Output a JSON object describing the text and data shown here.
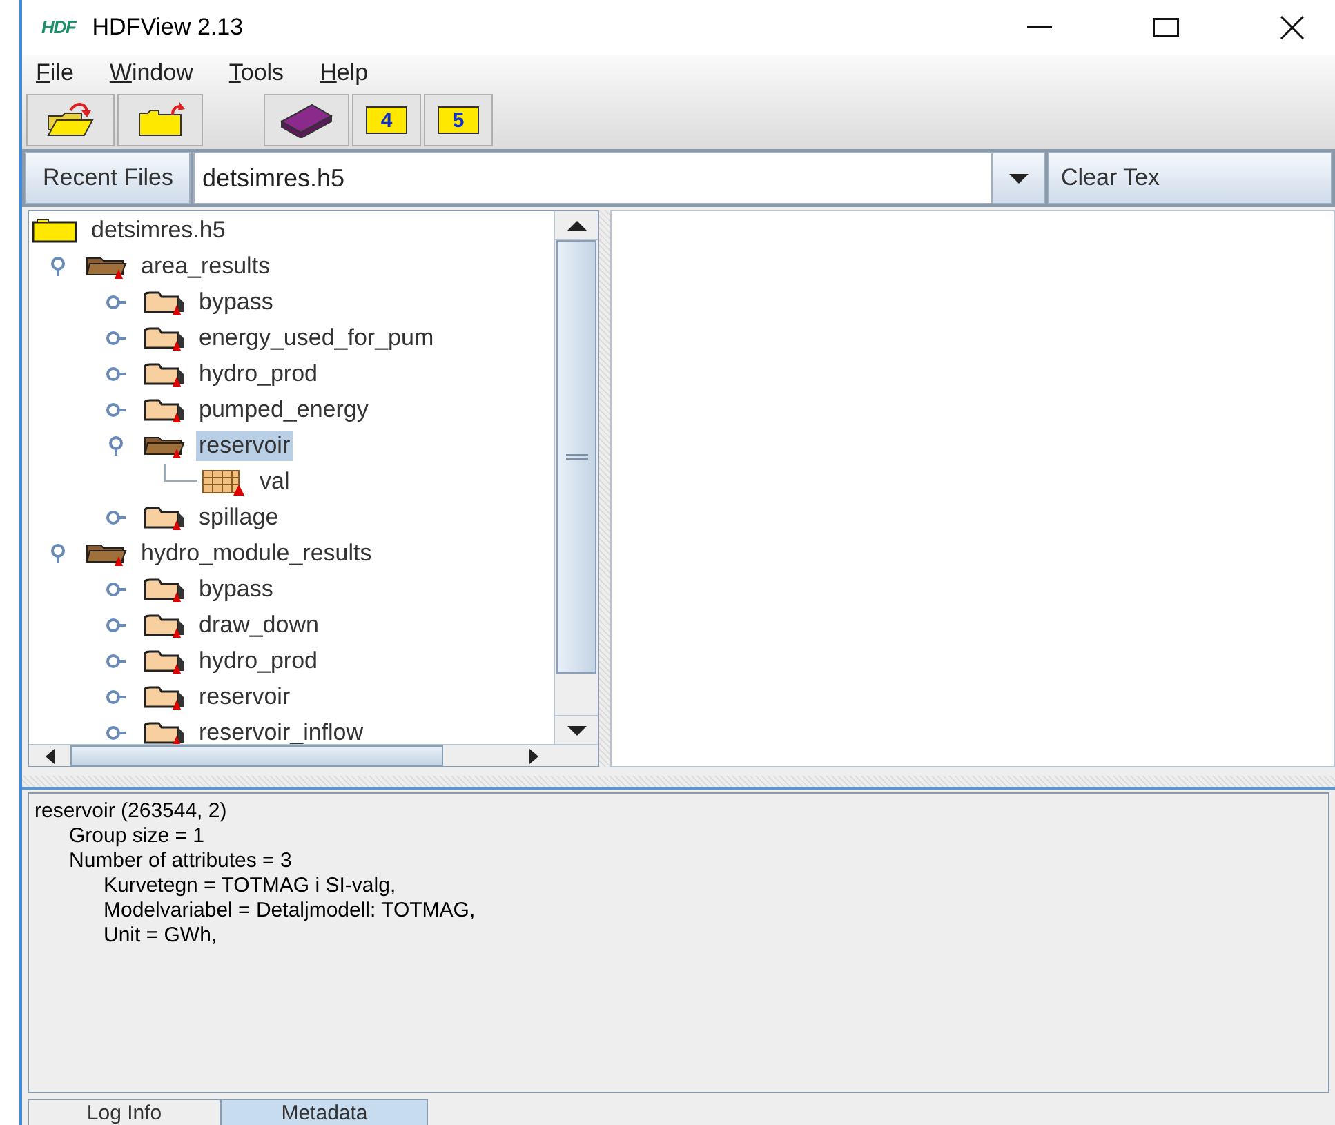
{
  "window": {
    "logo": "HDF",
    "title": "HDFView 2.13"
  },
  "menu": [
    "File",
    "Window",
    "Tools",
    "Help"
  ],
  "toolbar": [
    {
      "kind": "open"
    },
    {
      "kind": "close"
    },
    {
      "kind": "help"
    },
    {
      "kind": "folder",
      "label": "4"
    },
    {
      "kind": "folder",
      "label": "5"
    }
  ],
  "recent_files": {
    "button": "Recent Files",
    "value": "detsimres.h5",
    "clear_button": "Clear Tex"
  },
  "tree": [
    {
      "kind": "file",
      "label": "detsimres.h5",
      "selected": false,
      "children": [
        {
          "kind": "group",
          "label": "area_results",
          "expanded": true,
          "selected": false,
          "children": [
            {
              "kind": "group",
              "label": "bypass",
              "expanded": false,
              "selected": false
            },
            {
              "kind": "group",
              "label": "energy_used_for_pum",
              "expanded": false,
              "selected": false
            },
            {
              "kind": "group",
              "label": "hydro_prod",
              "expanded": false,
              "selected": false
            },
            {
              "kind": "group",
              "label": "pumped_energy",
              "expanded": false,
              "selected": false
            },
            {
              "kind": "group",
              "label": "reservoir",
              "expanded": true,
              "selected": true,
              "children": [
                {
                  "kind": "dataset",
                  "label": "val",
                  "selected": false
                }
              ]
            },
            {
              "kind": "group",
              "label": "spillage",
              "expanded": false,
              "selected": false
            }
          ]
        },
        {
          "kind": "group",
          "label": "hydro_module_results",
          "expanded": true,
          "selected": false,
          "children": [
            {
              "kind": "group",
              "label": "bypass",
              "expanded": false,
              "selected": false
            },
            {
              "kind": "group",
              "label": "draw_down",
              "expanded": false,
              "selected": false
            },
            {
              "kind": "group",
              "label": "hydro_prod",
              "expanded": false,
              "selected": false
            },
            {
              "kind": "group",
              "label": "reservoir",
              "expanded": false,
              "selected": false
            },
            {
              "kind": "group",
              "label": "reservoir_inflow",
              "expanded": false,
              "selected": false
            }
          ]
        }
      ]
    }
  ],
  "info_lines": [
    {
      "text": "reservoir (263544, 2)",
      "children": [
        {
          "text": "Group size = 1"
        },
        {
          "text": "Number of attributes = 3",
          "children": [
            {
              "text": "Kurvetegn = TOTMAG i SI-valg,"
            },
            {
              "text": "Modelvariabel = Detaljmodell: TOTMAG,"
            },
            {
              "text": "Unit = GWh,"
            }
          ]
        }
      ]
    }
  ],
  "bottom_tabs": [
    {
      "label": "Log Info",
      "selected": false
    },
    {
      "label": "Metadata",
      "selected": true
    }
  ]
}
